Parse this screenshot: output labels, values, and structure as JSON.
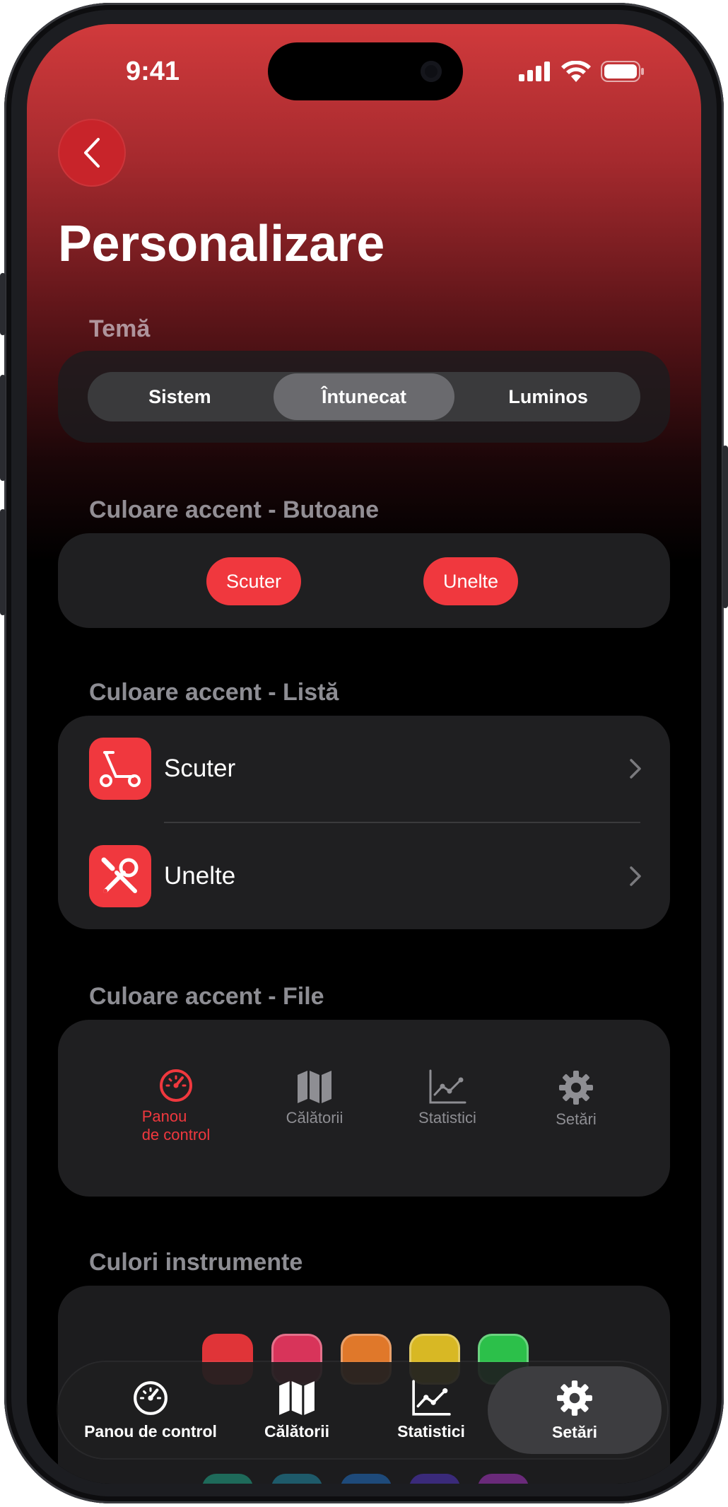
{
  "status_bar": {
    "time": "9:41"
  },
  "header": {
    "title": "Personalizare"
  },
  "theme": {
    "label": "Temă",
    "options": [
      "Sistem",
      "Întunecat",
      "Luminos"
    ],
    "selected": "Întunecat"
  },
  "accent_buttons": {
    "label": "Culoare accent - Butoane",
    "buttons": [
      "Scuter",
      "Unelte"
    ]
  },
  "accent_list": {
    "label": "Culoare accent - Listă",
    "items": [
      {
        "label": "Scuter",
        "icon": "scooter-icon"
      },
      {
        "label": "Unelte",
        "icon": "tools-icon"
      }
    ]
  },
  "accent_tabs": {
    "label": "Culoare accent - File",
    "items": [
      {
        "label": "Panou de control",
        "line1": "Panou",
        "line2": "de control",
        "icon": "speedometer-icon",
        "active": true
      },
      {
        "label": "Călătorii",
        "icon": "map-icon",
        "active": false
      },
      {
        "label": "Statistici",
        "icon": "chart-icon",
        "active": false
      },
      {
        "label": "Setări",
        "icon": "gear-icon",
        "active": false
      }
    ]
  },
  "tool_colors": {
    "label": "Culori instrumente",
    "swatches": [
      "#e03438",
      "#d8345a",
      "#e0782a",
      "#d8b824",
      "#2cc04a"
    ],
    "bottom_swatches": [
      "#1e6a5a",
      "#1e5a6a",
      "#1e4a7a",
      "#3a2a7a",
      "#6a2a7a"
    ]
  },
  "tab_bar": {
    "items": [
      {
        "label": "Panou de control",
        "icon": "speedometer-icon"
      },
      {
        "label": "Călătorii",
        "icon": "map-icon"
      },
      {
        "label": "Statistici",
        "icon": "chart-icon"
      },
      {
        "label": "Setări",
        "icon": "gear-icon",
        "active": true
      }
    ]
  },
  "colors": {
    "accent": "#f0383e",
    "card": "#1f1f21",
    "muted_text": "#8e8e93"
  }
}
